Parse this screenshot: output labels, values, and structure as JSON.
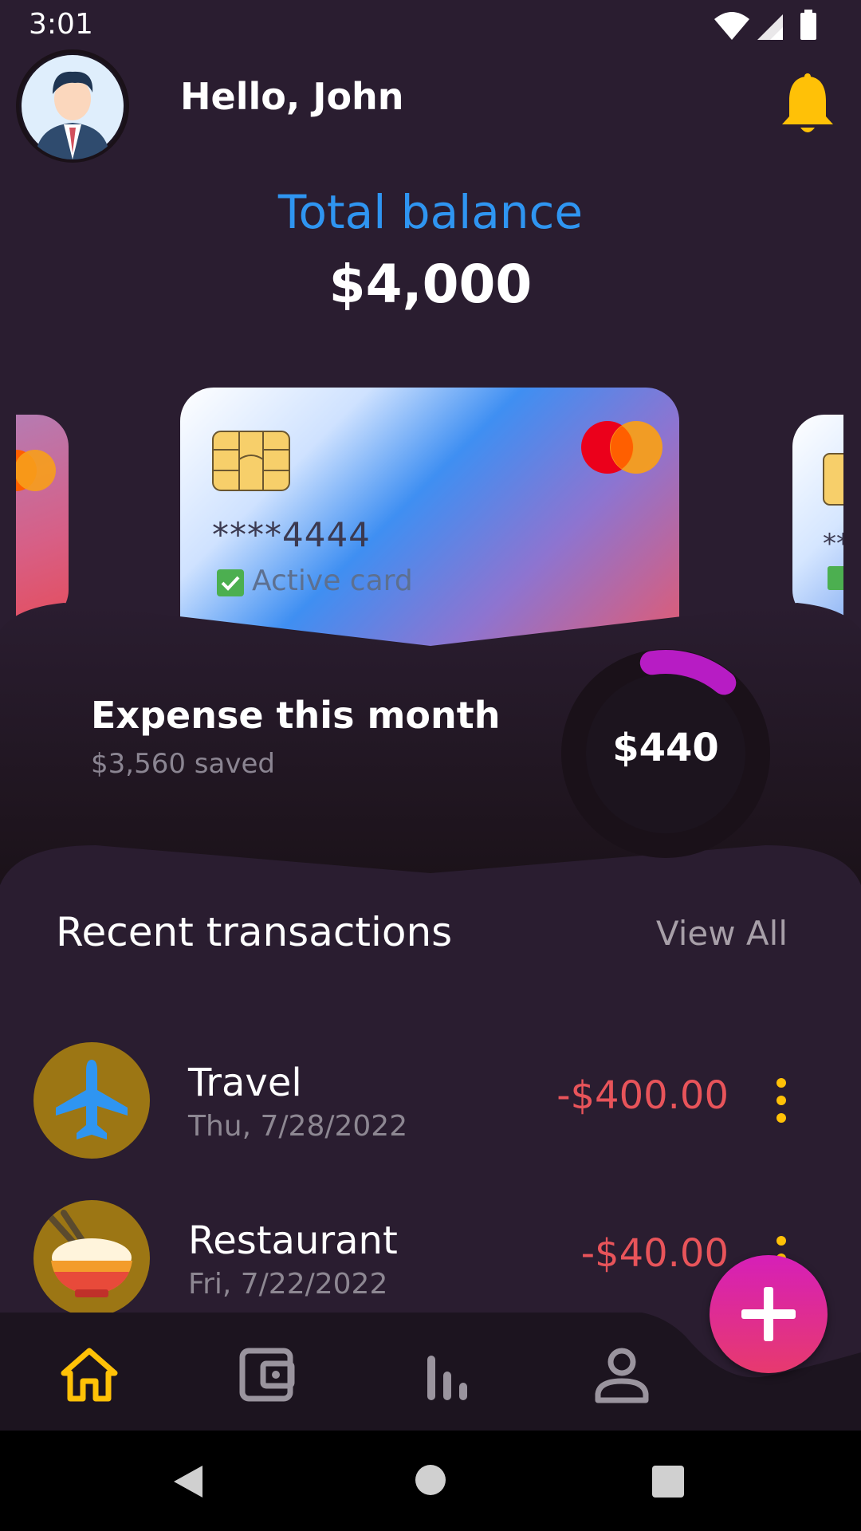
{
  "status_bar": {
    "time": "3:01"
  },
  "header": {
    "greeting": "Hello, John"
  },
  "balance": {
    "label": "Total balance",
    "value": "$4,000"
  },
  "card": {
    "number": "****4444",
    "status": "Active card"
  },
  "expense": {
    "title": "Expense this month",
    "saved": "$3,560 saved",
    "amount": "$440",
    "progress_fraction": 0.11
  },
  "transactions": {
    "title": "Recent transactions",
    "view_all": "View All",
    "items": [
      {
        "name": "Travel",
        "date": "Thu, 7/28/2022",
        "amount": "-$400.00",
        "icon": "airplane-icon"
      },
      {
        "name": "Restaurant",
        "date": "Fri, 7/22/2022",
        "amount": "-$40.00",
        "icon": "rice-bowl-icon"
      }
    ]
  },
  "nav": {
    "items": [
      "home",
      "wallet",
      "stats",
      "profile"
    ],
    "active": "home"
  },
  "colors": {
    "background": "#2a1d30",
    "accent_blue": "#2f95f1",
    "accent_yellow": "#ffc107",
    "expense_red": "#e8545a",
    "ring_progress": "#b71cc4",
    "fab_gradient_top": "#d61fb8",
    "fab_gradient_bottom": "#e73a6e"
  }
}
